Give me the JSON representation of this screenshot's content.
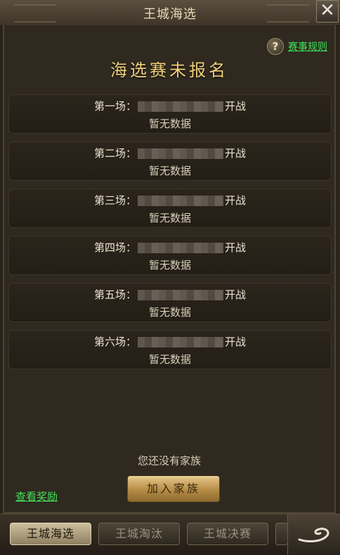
{
  "window": {
    "title": "王城海选",
    "close_glyph": "✕"
  },
  "header": {
    "help_icon": "?",
    "rules_label": "赛事规则",
    "status": "海选赛未报名"
  },
  "rounds": [
    {
      "label": "第一场：",
      "suffix": "开战",
      "result": "暂无数据"
    },
    {
      "label": "第二场：",
      "suffix": "开战",
      "result": "暂无数据"
    },
    {
      "label": "第三场：",
      "suffix": "开战",
      "result": "暂无数据"
    },
    {
      "label": "第四场：",
      "suffix": "开战",
      "result": "暂无数据"
    },
    {
      "label": "第五场：",
      "suffix": "开战",
      "result": "暂无数据"
    },
    {
      "label": "第六场：",
      "suffix": "开战",
      "result": "暂无数据"
    }
  ],
  "footer": {
    "no_family": "您还没有家族",
    "view_reward": "查看奖励",
    "join_family": "加入家族"
  },
  "tabs": [
    {
      "label": "王城海选",
      "active": true
    },
    {
      "label": "王城淘汰",
      "active": false
    },
    {
      "label": "王城决赛",
      "active": false
    }
  ],
  "icons": {
    "help": "help-icon",
    "close": "close-icon",
    "corner": "swirl-icon"
  },
  "colors": {
    "accent_green": "#3fe35a",
    "title_gold": "#f0d07a"
  }
}
